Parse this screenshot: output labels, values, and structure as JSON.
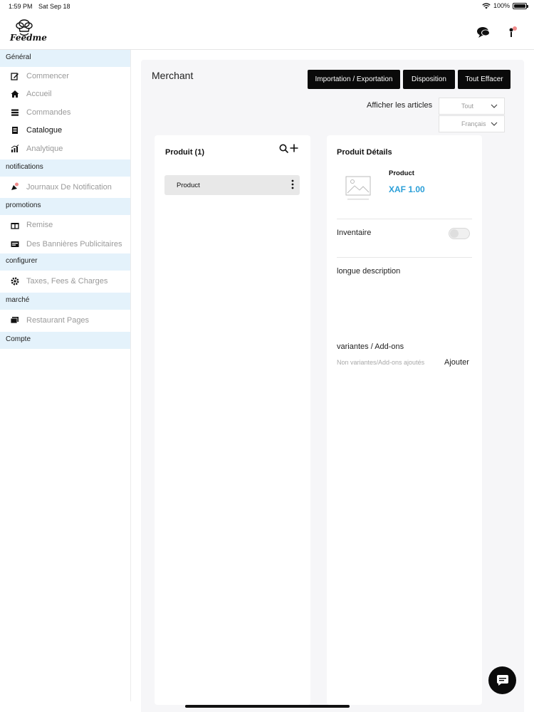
{
  "status_bar": {
    "time": "1:59 PM",
    "date": "Sat Sep 18",
    "battery": "100%",
    "battery_level": 1.0
  },
  "header": {
    "logo_text": "Feedme",
    "icons": [
      "chat-bubbles-icon",
      "notification-person-icon"
    ]
  },
  "sidebar": {
    "sections": [
      {
        "title": "Général",
        "items": [
          {
            "label": "Commencer",
            "icon": "edit-icon"
          },
          {
            "label": "Accueil",
            "icon": "home-icon"
          },
          {
            "label": "Commandes",
            "icon": "list-icon"
          },
          {
            "label": "Catalogue",
            "icon": "book-icon",
            "active": true
          },
          {
            "label": "Analytique",
            "icon": "chart-icon"
          }
        ]
      },
      {
        "title": "notifications",
        "items": [
          {
            "label": "Journaux De Notification",
            "icon": "notification-icon"
          }
        ]
      },
      {
        "title": "promotions",
        "items": [
          {
            "label": "Remise",
            "icon": "gift-icon"
          },
          {
            "label": "Des Bannières Publicitaires",
            "icon": "banner-icon"
          }
        ]
      },
      {
        "title": "configurer",
        "items": [
          {
            "label": "Taxes, Fees & Charges",
            "icon": "gear-icon"
          }
        ]
      },
      {
        "title": "marché",
        "items": [
          {
            "label": "Restaurant Pages",
            "icon": "pages-icon"
          }
        ]
      },
      {
        "title": "Compte",
        "items": []
      }
    ]
  },
  "main": {
    "page_title": "Merchant",
    "buttons": {
      "import_export": "Importation / Exportation",
      "layout": "Disposition",
      "clear_all": "Tout Effacer"
    },
    "filter_label": "Afficher les articles",
    "filter_select": "Tout",
    "language_select": "Français",
    "products_panel": {
      "title": "Produit (1)",
      "items": [
        "Product"
      ]
    },
    "details_panel": {
      "title": "Produit Détails",
      "product_name": "Product",
      "price": "XAF 1.00",
      "inventory_label": "Inventaire",
      "inventory_enabled": false,
      "long_description_label": "longue description",
      "variants_label": "variantes / Add-ons",
      "no_variants_text": "Non variantes/Add-ons ajoutés",
      "add_label": "Ajouter"
    }
  },
  "colors": {
    "sidebar_section_bg": "#e4f2fb",
    "price": "#2b9fd8",
    "button_bg": "#0a0a0a",
    "content_bg": "#f6f6f8"
  }
}
